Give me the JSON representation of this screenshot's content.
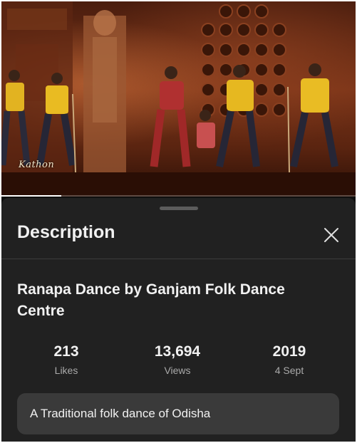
{
  "video": {
    "watermark": "Kathon",
    "progress": 0.17
  },
  "sheet": {
    "title": "Description",
    "close_icon": "close-icon"
  },
  "details": {
    "title": "Ranapa Dance by Ganjam Folk Dance Centre",
    "stats": [
      {
        "value": "213",
        "label": "Likes"
      },
      {
        "value": "13,694",
        "label": "Views"
      },
      {
        "value": "2019",
        "label": "4 Sept"
      }
    ],
    "description": "A Traditional folk dance of Odisha"
  },
  "colors": {
    "background": "#0f0f0f",
    "sheet": "#212121",
    "description_box": "#3a3a3a",
    "text_primary": "#f1f1f1",
    "text_secondary": "#aaaaaa"
  }
}
